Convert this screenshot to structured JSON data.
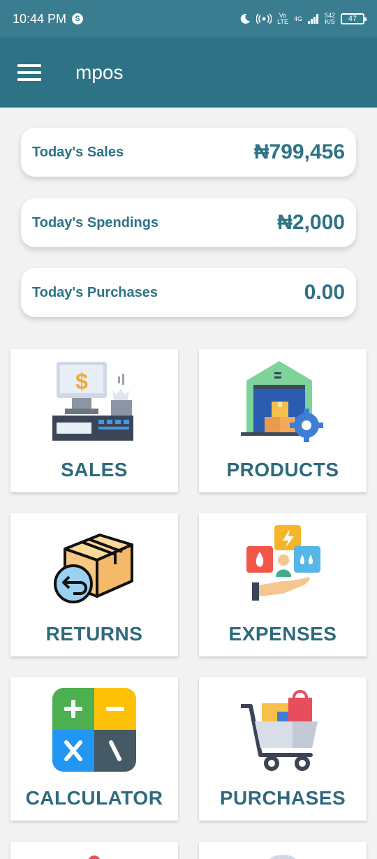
{
  "status_bar": {
    "time": "10:44 PM",
    "skype_glyph": "S",
    "volte_top": "Vo",
    "volte_bottom": "LTE",
    "network": "4G",
    "speed_top": "542",
    "speed_bottom": "K/S",
    "battery": "47"
  },
  "app_bar": {
    "title": "mpos",
    "menu_icon": "hamburger-menu-icon"
  },
  "stats": [
    {
      "label": "Today's Sales",
      "value": "₦799,456"
    },
    {
      "label": "Today's Spendings",
      "value": "₦2,000"
    },
    {
      "label": "Today's Purchases",
      "value": "0.00"
    }
  ],
  "tiles": [
    {
      "label": "SALES",
      "icon": "cash-register-icon"
    },
    {
      "label": "PRODUCTS",
      "icon": "warehouse-icon"
    },
    {
      "label": "RETURNS",
      "icon": "box-return-icon"
    },
    {
      "label": "EXPENSES",
      "icon": "utilities-expenses-icon"
    },
    {
      "label": "CALCULATOR",
      "icon": "calculator-icon"
    },
    {
      "label": "PURCHASES",
      "icon": "shopping-cart-icon"
    }
  ],
  "colors": {
    "status_bar": "#3a7d90",
    "app_bar": "#2e7285",
    "accent_text": "#2e7285",
    "background": "#f2f2f2"
  }
}
